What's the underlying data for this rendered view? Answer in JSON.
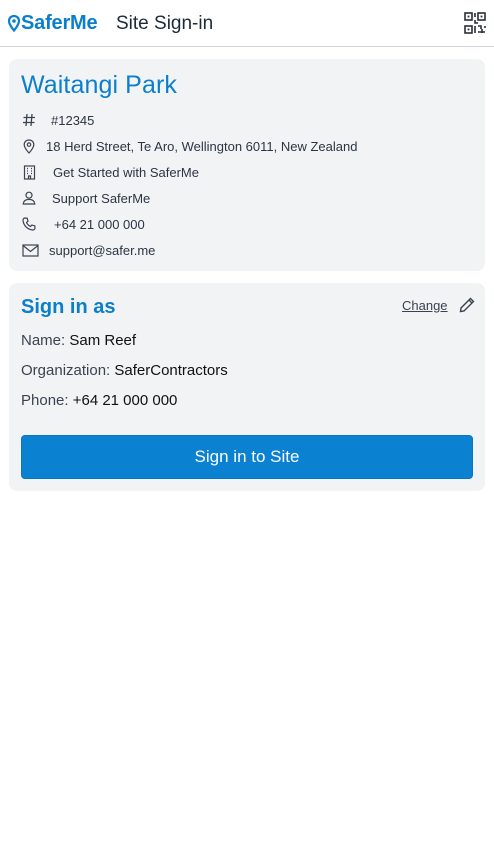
{
  "header": {
    "logo_text": "SaferMe",
    "title": "Site Sign-in",
    "qr_icon": "qr-code-icon"
  },
  "site": {
    "name": "Waitangi Park",
    "rows": [
      {
        "icon": "hash-icon",
        "text": "#12345"
      },
      {
        "icon": "map-pin-icon",
        "text": "18 Herd Street, Te Aro, Wellington 6011, New Zealand"
      },
      {
        "icon": "building-icon",
        "text": "Get Started with SaferMe"
      },
      {
        "icon": "user-icon",
        "text": "Support SaferMe"
      },
      {
        "icon": "phone-icon",
        "text": "+64 21 000 000"
      },
      {
        "icon": "mail-icon",
        "text": "support@safer.me"
      }
    ]
  },
  "signin": {
    "heading": "Sign in as",
    "change_label": "Change",
    "name_label": "Name:",
    "name_value": "Sam Reef",
    "org_label": "Organization:",
    "org_value": "SaferContractors",
    "phone_label": "Phone:",
    "phone_value": "+64 21 000 000",
    "button_label": "Sign in to Site"
  },
  "colors": {
    "brand": "#0b7fcb",
    "button": "#0a82d1",
    "card_bg": "#f2f3f5"
  }
}
